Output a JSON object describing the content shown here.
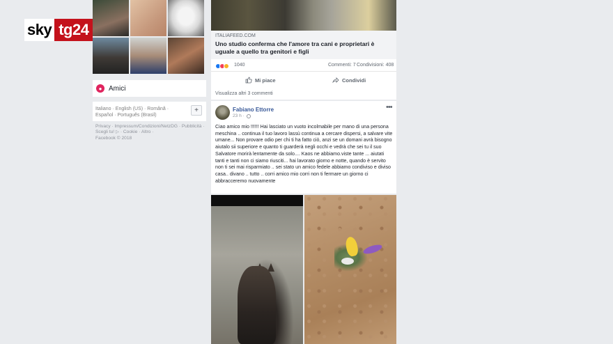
{
  "brand": {
    "sky": "sky",
    "tg": "tg24",
    "tg_color": "#c4121c"
  },
  "sidebar": {
    "friends_label": "Amici",
    "languages": "Italiano · English (US) · Română · Español · Português (Brasil)",
    "add_language": "+",
    "footer": "Privacy · Impressum/Condizioni/NetzDG · Pubblicità · Scegli tu! ▷ · Cookie · Altro ·",
    "copyright": "Facebook © 2018"
  },
  "post1": {
    "link_domain": "ITALIAFEED.COM",
    "link_title": "Uno studio conferma che l'amore tra cani e proprietari è uguale a quello tra genitori e figli",
    "reactions_count": "1040",
    "comments": "Commenti: 7",
    "shares": "Condivisioni: 408",
    "like_label": "Mi piace",
    "share_label": "Condividi",
    "more_comments": "Visualizza altri 3 commenti"
  },
  "post2": {
    "author": "Fabiano Ettorre",
    "time": "23 h ·",
    "more": "•••",
    "text": "Ciao amico mio !!!!!! Hai lasciato un vuoto incolmabile per mano di una persona meschina .. continua il tuo lavoro lassù continua a cercare dispersi, a salvare vite umane... Non provare odio per chi ti ha fatto ciò, anzi se un domani avrà bisogno aiutalo sii superiore e quanto ti guarderà negli occhi e vedrà che sei tu il suo Salvatore morirà lentamente da solo.... Kaos ne abbiamo.viste tante ... aiutati tanti e tanti non ci siamo riusciti... hai lavorato giorno e notte, quando è servito non ti sei mai risparmiato .. sei stato un amico fedele abbiamo condiviso e diviso casa.. divano .. tutto .. corri amico mio corri non ti fermare un giorno ci abbracceremo nuovamente"
  }
}
